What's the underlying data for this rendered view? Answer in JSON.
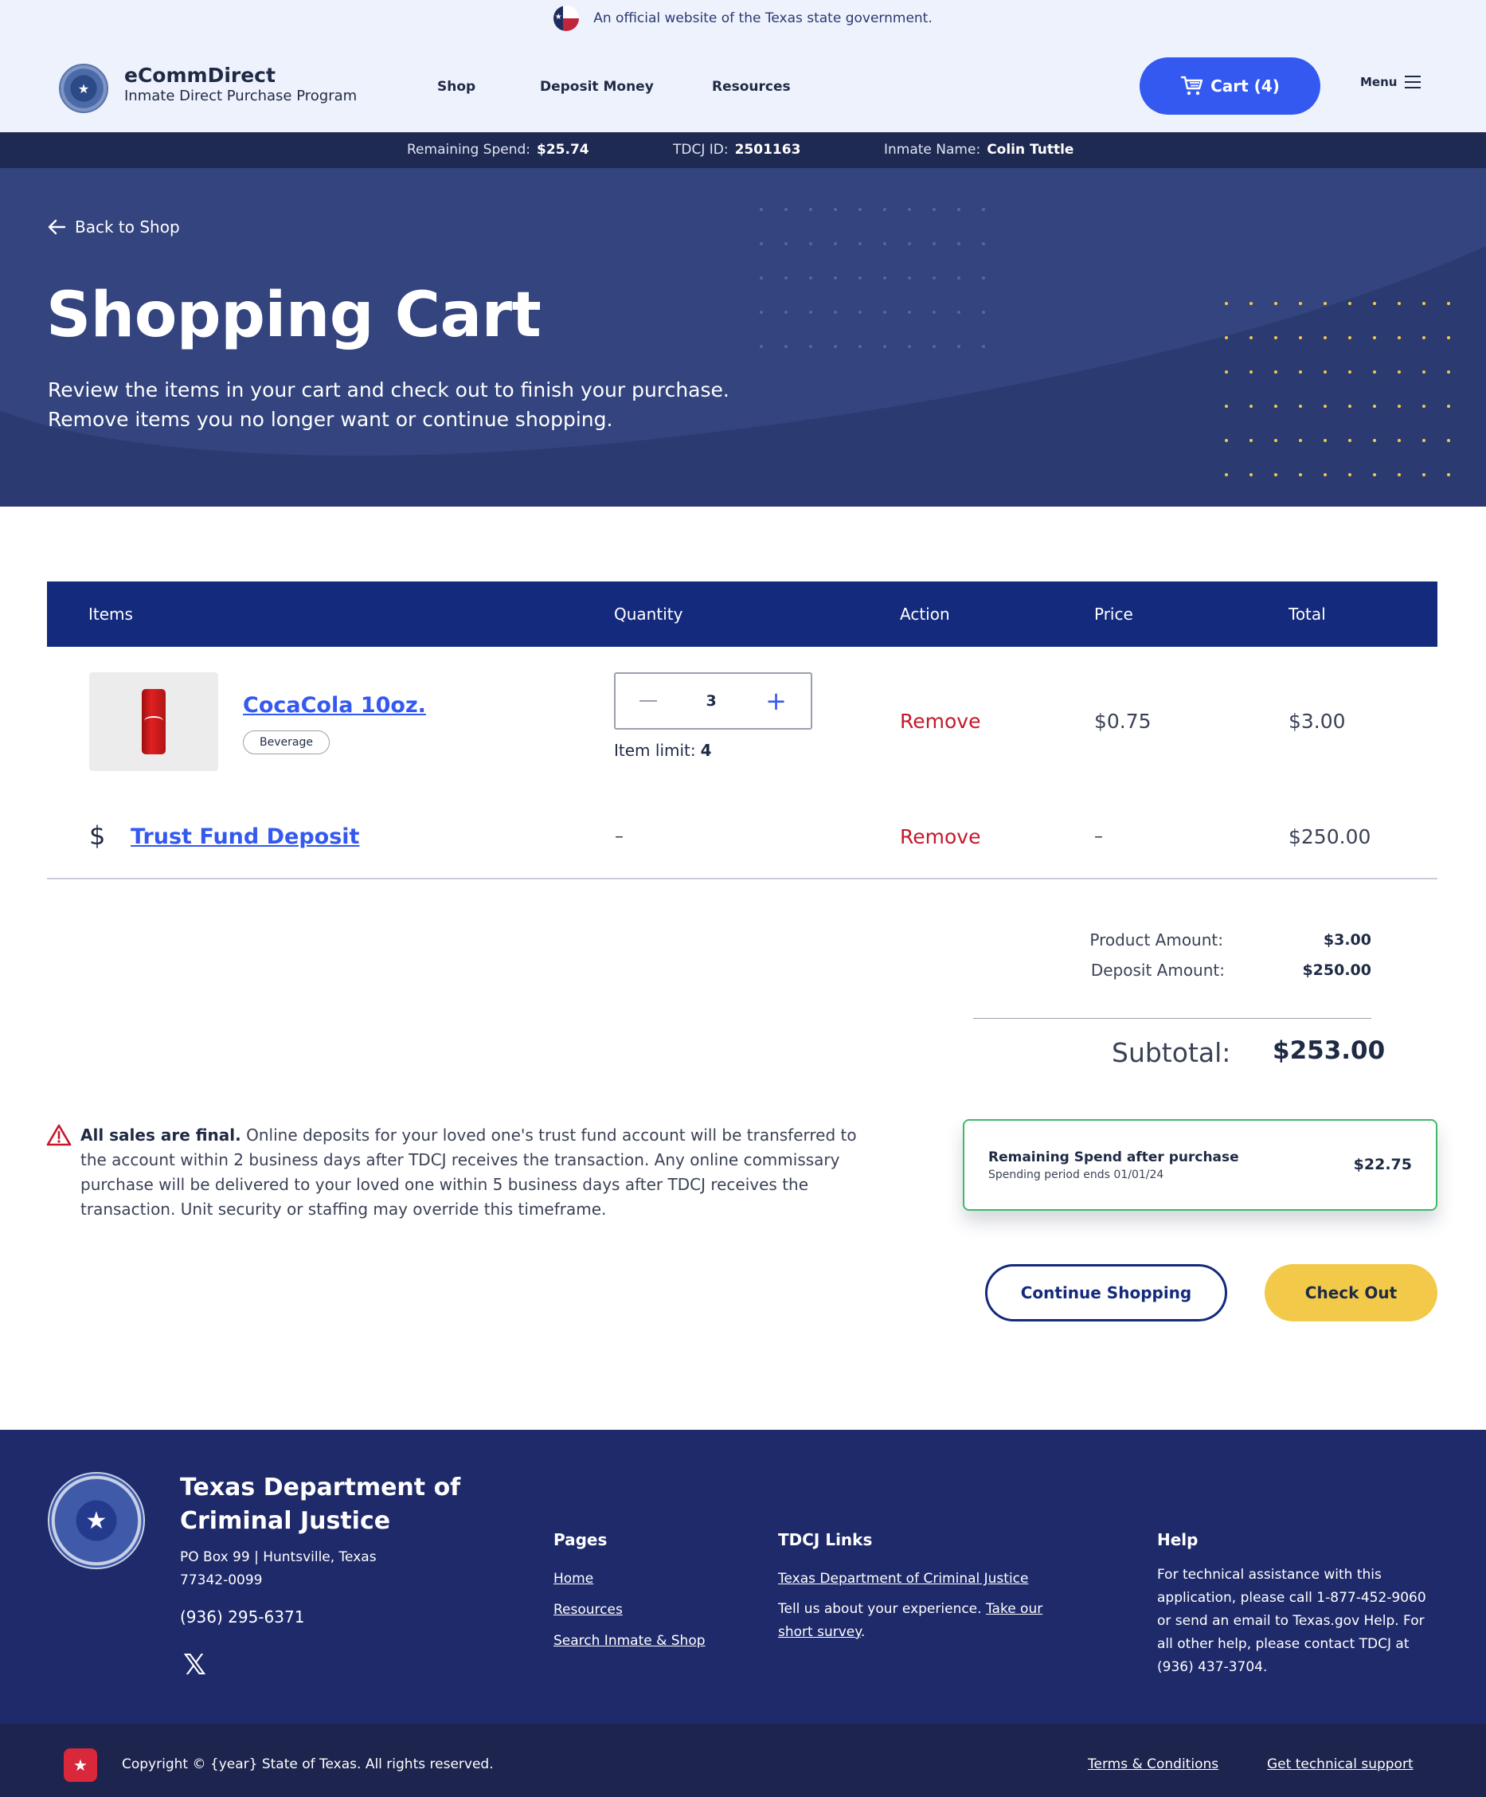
{
  "gov_banner": {
    "text": "An official website of the Texas state government."
  },
  "header": {
    "brand_title": "eCommDirect",
    "brand_subtitle": "Inmate Direct Purchase Program",
    "nav": [
      "Shop",
      "Deposit Money",
      "Resources"
    ],
    "cart_label": "Cart (4)",
    "menu_label": "Menu"
  },
  "info_bar": {
    "remaining_label": "Remaining Spend:",
    "remaining_value": "$25.74",
    "id_label": "TDCJ ID:",
    "id_value": "2501163",
    "name_label": "Inmate Name:",
    "name_value": "Colin Tuttle"
  },
  "hero": {
    "back_label": "Back to Shop",
    "title": "Shopping Cart",
    "line1": "Review the items in your cart and check out to finish your purchase.",
    "line2": "Remove items you no longer want or continue shopping."
  },
  "table": {
    "headers": [
      "Items",
      "Quantity",
      "Action",
      "Price",
      "Total"
    ],
    "product": {
      "name": "CocaCola 10oz.",
      "badge": "Beverage",
      "quantity": "3",
      "limit_label": "Item limit:",
      "limit_value": "4",
      "action": "Remove",
      "price": "$0.75",
      "total": "$3.00"
    },
    "deposit": {
      "name": "Trust Fund Deposit",
      "quantity": "–",
      "action": "Remove",
      "price": "–",
      "total": "$250.00"
    }
  },
  "summary": {
    "product_label": "Product Amount:",
    "product_value": "$3.00",
    "deposit_label": "Deposit Amount:",
    "deposit_value": "$250.00",
    "subtotal_label": "Subtotal:",
    "subtotal_value": "$253.00"
  },
  "warning": {
    "bold": "All sales are final.",
    "text": "Online deposits for your loved one's trust fund account will be transferred to the account within 2 business days after TDCJ receives the transaction. Any online commissary purchase will be delivered to your loved one within 5 business days after TDCJ receives the transaction. Unit security or staffing may override this timeframe."
  },
  "remaining_card": {
    "title": "Remaining Spend after purchase",
    "subtitle": "Spending period ends 01/01/24",
    "value": "$22.75"
  },
  "buttons": {
    "continue": "Continue Shopping",
    "checkout": "Check Out"
  },
  "footer": {
    "title": "Texas Department of Criminal Justice",
    "address": "PO Box 99 | Huntsville, Texas 77342-0099",
    "phone": "(936) 295-6371",
    "pages_title": "Pages",
    "pages": [
      "Home",
      "Resources",
      "Search Inmate & Shop"
    ],
    "links_title": "TDCJ Links",
    "links_main": "Texas Department of Criminal Justice",
    "links_text": "Tell us about your experience.",
    "links_survey": "Take our short survey",
    "help_title": "Help",
    "help_text": "For technical assistance with this application, please call 1-877-452-9060 or send an email to Texas.gov Help. For all other help, please contact TDCJ at (936) 437-3704."
  },
  "bottom_bar": {
    "copyright": "Copyright © {year} State of Texas. All rights reserved.",
    "terms": "Terms & Conditions",
    "support": "Get technical support"
  },
  "colors": {
    "primary": "#3459f0",
    "navy": "#142a7c",
    "accent_yellow": "#f3c94a",
    "remove_red": "#c4182b",
    "success_green": "#3fb86a"
  }
}
